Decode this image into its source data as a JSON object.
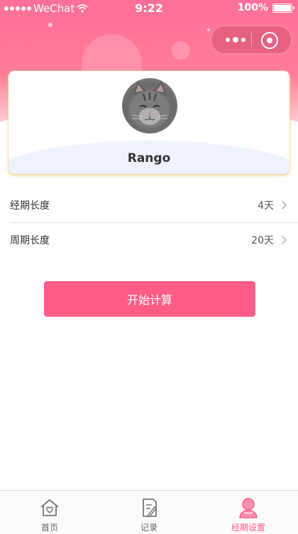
{
  "status_bar": {
    "carrier": "WeChat",
    "time": "9:22",
    "battery": "100%"
  },
  "profile": {
    "name": "Rango"
  },
  "settings": [
    {
      "label": "经期长度",
      "value": "4天"
    },
    {
      "label": "周期长度",
      "value": "20天"
    }
  ],
  "start_button": "开始计算",
  "tabs": [
    {
      "label": "首页",
      "icon": "home-icon",
      "active": false
    },
    {
      "label": "记录",
      "icon": "record-icon",
      "active": false
    },
    {
      "label": "经期设置",
      "icon": "period-settings-icon",
      "active": true
    }
  ],
  "colors": {
    "accent": "#ff5c87",
    "header": "#ff6f97"
  }
}
